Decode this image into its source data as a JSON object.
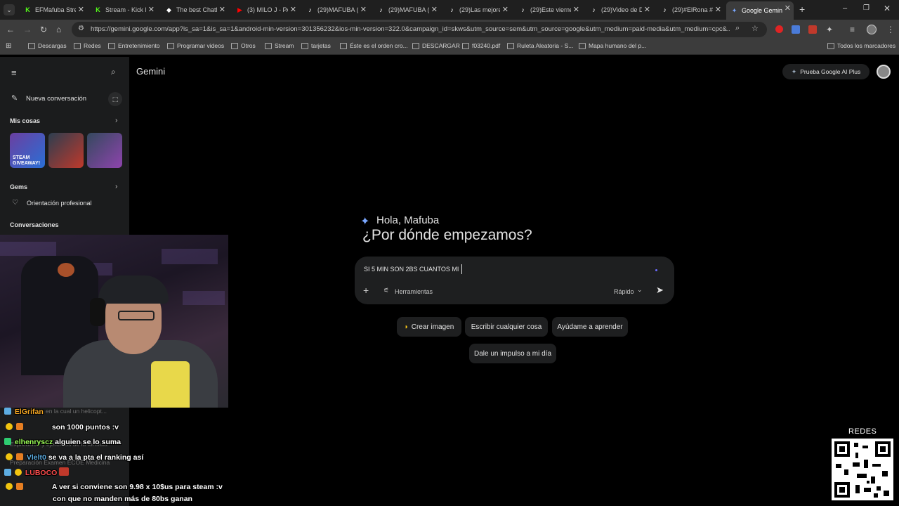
{
  "tabs": [
    {
      "label": "EFMafuba Stre",
      "icon": "kick-icon",
      "color": "#53fc18"
    },
    {
      "label": "Stream - Kick D",
      "icon": "kick-icon",
      "color": "#53fc18"
    },
    {
      "label": "The best ChatB",
      "icon": "shield-icon",
      "color": "#ffffff"
    },
    {
      "label": "(3) MILO J - PA",
      "icon": "youtube-icon",
      "color": "#ff0000"
    },
    {
      "label": "(29)MAFUBA (",
      "icon": "tiktok-icon",
      "color": "#ffffff"
    },
    {
      "label": "(29)MAFUBA (",
      "icon": "tiktok-icon",
      "color": "#ffffff"
    },
    {
      "label": "(29)Las mejore",
      "icon": "tiktok-icon",
      "color": "#ffffff"
    },
    {
      "label": "(29)Este vierne",
      "icon": "tiktok-icon",
      "color": "#ffffff"
    },
    {
      "label": "(29)Video de D",
      "icon": "tiktok-icon",
      "color": "#ffffff"
    },
    {
      "label": "(29)#ElRona #",
      "icon": "tiktok-icon",
      "color": "#ffffff"
    },
    {
      "label": "Google Gemini",
      "icon": "gemini-icon",
      "color": "#7aa7ff"
    }
  ],
  "browser": {
    "url": "https://gemini.google.com/app?is_sa=1&is_sa=1&android-min-version=301356232&ios-min-version=322.0&campaign_id=skws&utm_source=sem&utm_source=google&utm_medium=paid-media&utm_medium=cpc&..."
  },
  "bookmarks": [
    "Descargas",
    "Redes",
    "Entretenimiento",
    "Programar videos",
    "Otros",
    "Stream",
    "tarjetas",
    "Éste es el orden cro...",
    "DESCARGAR",
    "f03240.pdf",
    "Ruleta Aleatoria - S...",
    "Mapa humano del p..."
  ],
  "bookmarks_all": "Todos los marcadores",
  "sidebar": {
    "new_chat": "Nueva conversación",
    "my_stuff": "Mis cosas",
    "gems": "Gems",
    "gem_item": "Orientación profesional",
    "conversations": "Conversaciones",
    "thumb_label": "STEAM GIVEAWAY!"
  },
  "main": {
    "title": "Gemini",
    "try_plus": "Prueba Google AI Plus",
    "greeting": "Hola, Mafuba",
    "headline": "¿Por dónde empezamos?",
    "prompt_value": "SI 5 MIN SON 2BS CUANTOS MI",
    "tools": "Herramientas",
    "mode": "Rápido"
  },
  "chips": [
    "Crear imagen",
    "Escribir cualquier cosa",
    "Ayúdame a aprender",
    "Dale un impulso a mi día"
  ],
  "chat": [
    {
      "user": "ElGrifan",
      "msg": "",
      "color": "#f5a623"
    },
    {
      "user": "",
      "msg": "son 1000 puntos :v",
      "color": "#ffffff"
    },
    {
      "user": "elhenryscz",
      "msg": "alguien se lo suma",
      "color": "#9cff57"
    },
    {
      "user": "Vlelt0",
      "msg": "se va a la pta el ranking así",
      "color": "#5dade2"
    },
    {
      "user": "LUBOCO",
      "msg": "",
      "color": "#ff4d4d"
    },
    {
      "user": "",
      "msg": "A ver si conviene son 9.98 x 10$us para steam :v",
      "color": "#ffffff"
    },
    {
      "user": "",
      "msg": "con que no manden más de 80bs ganan",
      "color": "#ffffff"
    }
  ],
  "ghost_texts": [
    "en la cual un helicopt...",
    "Explicación y ejercicios de la fórmula",
    "Preparación Examen ECOE Medicina"
  ],
  "overlay": {
    "redes": "REDES"
  }
}
